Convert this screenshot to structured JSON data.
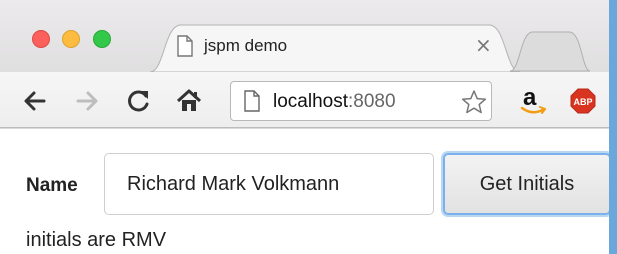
{
  "browser": {
    "tab": {
      "title": "jspm demo",
      "close_glyph": "×"
    },
    "address_bar": {
      "host": "localhost",
      "port": ":8080"
    },
    "extensions": [
      {
        "name": "amazon-icon",
        "glyph": "a"
      },
      {
        "name": "adblock-plus-icon",
        "glyph": "ABP"
      }
    ],
    "colors": {
      "close": "#fc605c",
      "minimize": "#fdbc40",
      "maximize": "#34c84a",
      "focus_ring": "#7ab1ea"
    }
  },
  "page": {
    "name_label": "Name",
    "name_input_value": "Richard Mark Volkmann",
    "button_label": "Get Initials",
    "result_text": "initials are RMV"
  }
}
